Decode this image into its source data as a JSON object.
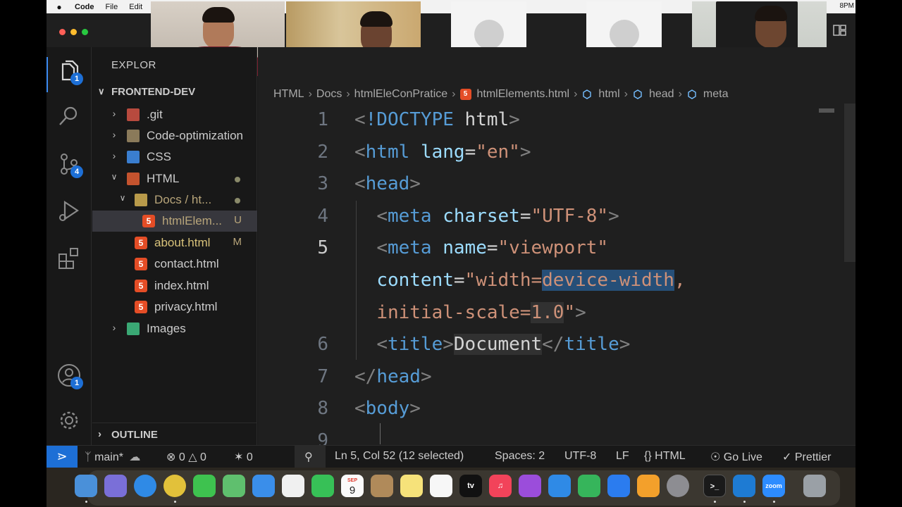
{
  "menubar": {
    "app_name": "Code",
    "items": [
      "File",
      "Edit"
    ],
    "clock": "8PM"
  },
  "activity_bar": {
    "badges": {
      "explorer": "1",
      "source_control": "4",
      "accounts": "1"
    }
  },
  "sidebar": {
    "title": "EXPLOR",
    "root_label": "FRONTEND-DEV",
    "tree": [
      {
        "label": ".git",
        "icon": "git-folder-icon"
      },
      {
        "label": "Code-optimization",
        "icon": "folder-icon"
      },
      {
        "label": "CSS",
        "icon": "css-folder-icon"
      },
      {
        "label": "HTML",
        "icon": "html-folder-icon"
      },
      {
        "label": "Docs / ht...",
        "icon": "folder-icon"
      },
      {
        "label": "htmlElem...",
        "icon": "html-file-icon",
        "decoration": "U"
      },
      {
        "label": "about.html",
        "icon": "html-file-icon",
        "decoration": "M"
      },
      {
        "label": "contact.html",
        "icon": "html-file-icon"
      },
      {
        "label": "index.html",
        "icon": "html-file-icon"
      },
      {
        "label": "privacy.html",
        "icon": "html-file-icon"
      },
      {
        "label": "Images",
        "icon": "images-folder-icon"
      }
    ],
    "outline_label": "OUTLINE"
  },
  "breadcrumb": [
    "HTML",
    "Docs",
    "htmlEleConPratice",
    "htmlElements.html",
    "html",
    "head",
    "meta"
  ],
  "editor": {
    "lines": [
      {
        "num": "1",
        "tokens": [
          [
            "t-punc",
            "<"
          ],
          [
            "t-tag",
            "!DOCTYPE"
          ],
          [
            "t-text",
            " html"
          ],
          [
            "t-punc",
            ">"
          ]
        ]
      },
      {
        "num": "2",
        "tokens": [
          [
            "t-punc",
            "<"
          ],
          [
            "t-tag",
            "html"
          ],
          [
            "t-text",
            " "
          ],
          [
            "t-attr",
            "lang"
          ],
          [
            "t-text",
            "="
          ],
          [
            "t-str",
            "\"en\""
          ],
          [
            "t-punc",
            ">"
          ]
        ]
      },
      {
        "num": "3",
        "tokens": [
          [
            "t-punc",
            "<"
          ],
          [
            "t-tag",
            "head"
          ],
          [
            "t-punc",
            ">"
          ]
        ]
      },
      {
        "num": "4",
        "tokens": [
          [
            "t-text",
            "  "
          ],
          [
            "t-punc",
            "<"
          ],
          [
            "t-tag",
            "meta"
          ],
          [
            "t-text",
            " "
          ],
          [
            "t-attr",
            "charset"
          ],
          [
            "t-text",
            "="
          ],
          [
            "t-str",
            "\"UTF-8\""
          ],
          [
            "t-punc",
            ">"
          ]
        ]
      },
      {
        "num": "5",
        "current": true,
        "tokens": [
          [
            "t-text",
            "  "
          ],
          [
            "t-punc",
            "<"
          ],
          [
            "t-tag",
            "meta"
          ],
          [
            "t-text",
            " "
          ],
          [
            "t-attr",
            "name"
          ],
          [
            "t-text",
            "="
          ],
          [
            "t-str",
            "\"viewport\""
          ]
        ]
      },
      {
        "num": "",
        "tokens": [
          [
            "t-text",
            "  "
          ],
          [
            "t-attr",
            "content"
          ],
          [
            "t-text",
            "="
          ],
          [
            "t-str",
            "\"width="
          ],
          [
            "t-str sel",
            "device-width"
          ],
          [
            "t-str",
            ","
          ]
        ]
      },
      {
        "num": "",
        "tokens": [
          [
            "t-text",
            "  "
          ],
          [
            "t-str",
            "initial-scale="
          ],
          [
            "t-str hl",
            "1.0"
          ],
          [
            "t-str",
            "\""
          ],
          [
            "t-punc",
            ">"
          ]
        ]
      },
      {
        "num": "6",
        "tokens": [
          [
            "t-text",
            "  "
          ],
          [
            "t-punc",
            "<"
          ],
          [
            "t-tag",
            "title"
          ],
          [
            "t-punc",
            ">"
          ],
          [
            "t-text hl",
            "Document"
          ],
          [
            "t-punc",
            "</"
          ],
          [
            "t-tag",
            "title"
          ],
          [
            "t-punc",
            ">"
          ]
        ]
      },
      {
        "num": "7",
        "tokens": [
          [
            "t-punc",
            "</"
          ],
          [
            "t-tag",
            "head"
          ],
          [
            "t-punc",
            ">"
          ]
        ]
      },
      {
        "num": "8",
        "tokens": [
          [
            "t-punc",
            "<"
          ],
          [
            "t-tag",
            "body"
          ],
          [
            "t-punc",
            ">"
          ]
        ]
      },
      {
        "num": "9",
        "tokens": []
      }
    ]
  },
  "statusbar": {
    "branch": "main*",
    "errors": "0",
    "warnings": "0",
    "ports": "0",
    "position": "Ln 5, Col 52 (12 selected)",
    "spaces": "Spaces: 2",
    "encoding": "UTF-8",
    "eol": "LF",
    "language": "HTML",
    "golive": "Go Live",
    "prettier": "Prettier"
  },
  "dock": {
    "calendar_month": "SEP",
    "calendar_day": "9",
    "tv_label": "tv",
    "zoom_label": "zoom"
  },
  "colors": {
    "accent": "#1d6fd6",
    "html_icon": "#e44d26",
    "selection": "#264f78"
  }
}
